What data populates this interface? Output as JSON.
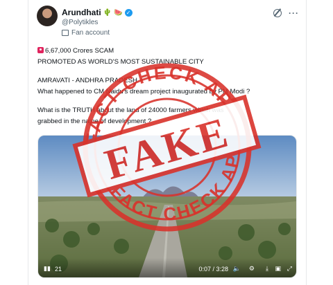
{
  "author": {
    "display_name": "Arundhati",
    "handle": "@Polytikles",
    "badge": "Fan account",
    "verified_mark": "✓"
  },
  "tweet": {
    "line1": "6,67,000 Crores SCAM",
    "line2": "PROMOTED AS WORLD'S MOST SUSTAINABLE CITY",
    "line3": "AMRAVATI - ANDHRA PRADESH",
    "line4": "What happened to CM Naidu's dream project inaugurated by PM Modi ?",
    "line5": "What is the TRUTH about the land of 24000 farmers which was",
    "line6": "grabbed in the name of development ?"
  },
  "video": {
    "time": "0:07 / 3:28",
    "progress_fraction": 0.034,
    "left_label": "21"
  },
  "stamp": {
    "top_text": "FACT CHECK AP",
    "center_text": "FAKE",
    "bottom_text": "FACT CHECK AP"
  },
  "icons": {
    "grok": "grok-icon",
    "more": "more-options-icon",
    "siren": "police-siren-icon",
    "play": "play-icon",
    "volume": "volume-icon",
    "settings": "settings-gear-icon",
    "download": "download-icon",
    "fullscreen": "fullscreen-icon"
  },
  "colors": {
    "stamp_red": "#d9322b",
    "verified_blue": "#1d9bf0",
    "sky_blue": "#6f97c7"
  }
}
